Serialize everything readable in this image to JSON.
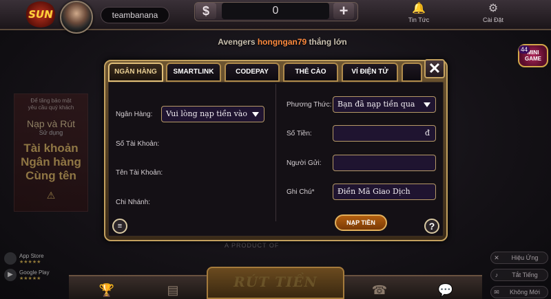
{
  "header": {
    "username": "teambanana",
    "balance": "0",
    "currency_symbol": "$",
    "news_label": "Tin Tức",
    "settings_label": "Cài Đặt"
  },
  "marquee": {
    "prefix": "Avengers",
    "player": "hongngan79",
    "suffix": "thắng lớn"
  },
  "minigame": {
    "count": "44",
    "label_line1": "MINI",
    "label_line2": "GAME"
  },
  "promo": {
    "note_line1": "Để tăng bảo mật",
    "note_line2": "yêu cầu quý khách",
    "title": "Nạp và Rút",
    "sub": "Sử dụng",
    "big1": "Tài khoản",
    "big2": "Ngân hàng",
    "big3": "Cùng tên"
  },
  "modal": {
    "tabs": [
      {
        "label": "NGÂN HÀNG"
      },
      {
        "label": "SMARTLINK"
      },
      {
        "label": "CODEPAY"
      },
      {
        "label": "THẺ CÀO"
      },
      {
        "label": "VÍ ĐIỆN TỬ"
      }
    ],
    "left": {
      "bank_label": "Ngân Hàng:",
      "bank_value": "Vui lòng nạp tiền vào",
      "account_no_label": "Số Tài Khoản:",
      "account_name_label": "Tên Tài Khoản:",
      "branch_label": "Chi Nhánh:"
    },
    "right": {
      "method_label": "Phương Thức:",
      "method_value": "Bạn đã nạp tiền qua",
      "amount_label": "Số Tiền:",
      "amount_suffix": "đ",
      "sender_label": "Người Gửi:",
      "note_label": "Ghi Chú*",
      "note_placeholder": "Điền Mã Giao Dịch"
    },
    "deposit_button": "NẠP TIỀN"
  },
  "footer": {
    "product_text": "A PRODUCT OF",
    "app_store": "App Store",
    "google_play": "Google Play",
    "stars": "★★★★★",
    "withdraw_label": "RÚT TIỀN",
    "effects_label": "Hiệu Ứng",
    "sound_label": "Tắt Tiếng",
    "no_new_label": "Không Mới"
  }
}
